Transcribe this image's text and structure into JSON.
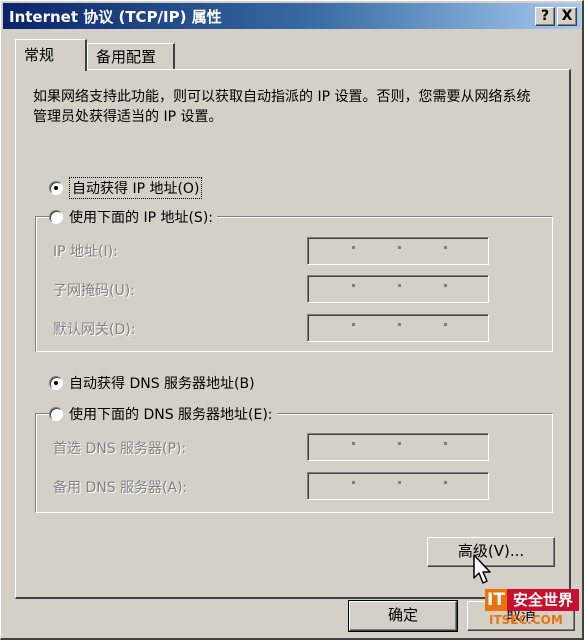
{
  "window": {
    "title": "Internet 协议 (TCP/IP) 属性",
    "help_label": "?",
    "close_label": "X"
  },
  "tabs": [
    {
      "label": "常规"
    },
    {
      "label": "备用配置"
    }
  ],
  "description": "如果网络支持此功能，则可以获取自动指派的 IP 设置。否则，您需要从网络系统管理员处获得适当的 IP 设置。",
  "ip": {
    "auto_label": "自动获得 IP 地址(O)",
    "auto_checked": true,
    "manual_label": "使用下面的 IP 地址(S):",
    "manual_checked": false,
    "fields": [
      {
        "label": "IP 地址(I):",
        "value": ""
      },
      {
        "label": "子网掩码(U):",
        "value": ""
      },
      {
        "label": "默认网关(D):",
        "value": ""
      }
    ]
  },
  "dns": {
    "auto_label": "自动获得 DNS 服务器地址(B)",
    "auto_checked": true,
    "manual_label": "使用下面的 DNS 服务器地址(E):",
    "manual_checked": false,
    "fields": [
      {
        "label": "首选 DNS 服务器(P):",
        "value": ""
      },
      {
        "label": "备用 DNS 服务器(A):",
        "value": ""
      }
    ]
  },
  "buttons": {
    "advanced": "高级(V)...",
    "ok": "确定",
    "cancel": "取消"
  },
  "watermark": {
    "logo": "IT",
    "name": "安全世界",
    "url": "ITSEC.COM"
  }
}
